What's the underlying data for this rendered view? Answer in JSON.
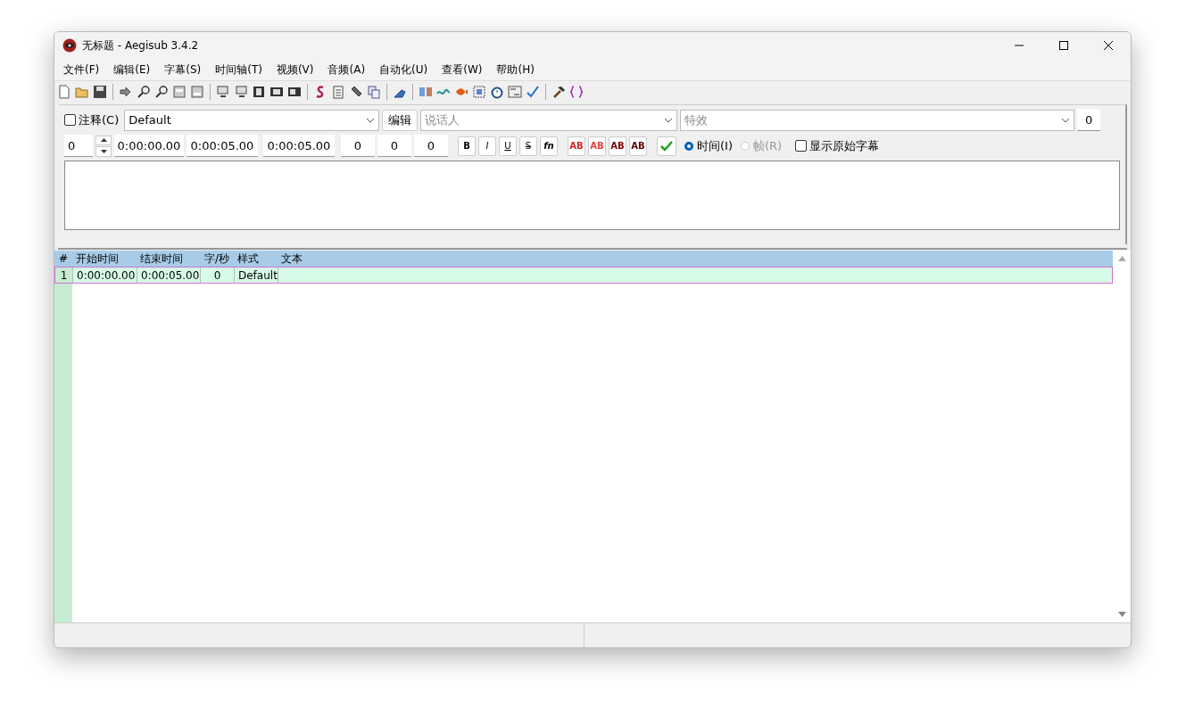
{
  "window": {
    "title": "无标题 - Aegisub 3.4.2"
  },
  "menu": [
    "文件(F)",
    "编辑(E)",
    "字幕(S)",
    "时间轴(T)",
    "视频(V)",
    "音频(A)",
    "自动化(U)",
    "查看(W)",
    "帮助(H)"
  ],
  "editor": {
    "comment": {
      "label": "注释(C)",
      "checked": false
    },
    "style": "Default",
    "edit_button": "编辑",
    "actor": {
      "placeholder": "说话人"
    },
    "effect": {
      "placeholder": "特效"
    },
    "effect_count": "0",
    "layer": "0",
    "start": "0:00:00.00",
    "end": "0:00:05.00",
    "duration": "0:00:05.00",
    "margins": [
      "0",
      "0",
      "0"
    ],
    "format_buttons": [
      {
        "kind": "bold",
        "label": "B"
      },
      {
        "kind": "italic",
        "label": "I"
      },
      {
        "kind": "underline",
        "label": "U"
      },
      {
        "kind": "strike",
        "label": "S"
      },
      {
        "kind": "font",
        "label": "fn"
      }
    ],
    "color_buttons": [
      {
        "label": "AB",
        "color": "#d42020"
      },
      {
        "label": "AB",
        "color": "#e04040"
      },
      {
        "label": "AB",
        "color": "#7a0000"
      },
      {
        "label": "AB",
        "color": "#5a0000"
      }
    ],
    "modes": [
      {
        "label": "时间(I)",
        "selected": true,
        "disabled": false
      },
      {
        "label": "帧(R)",
        "selected": false,
        "disabled": true
      }
    ],
    "show_original": {
      "label": "显示原始字幕",
      "checked": false
    }
  },
  "grid": {
    "columns": [
      "#",
      "开始时间",
      "结束时间",
      "字/秒",
      "样式",
      "文本"
    ],
    "rows": [
      {
        "cells": [
          "1",
          "0:00:00.00",
          "0:00:05.00",
          "0",
          "Default",
          ""
        ],
        "selected": true
      }
    ]
  }
}
